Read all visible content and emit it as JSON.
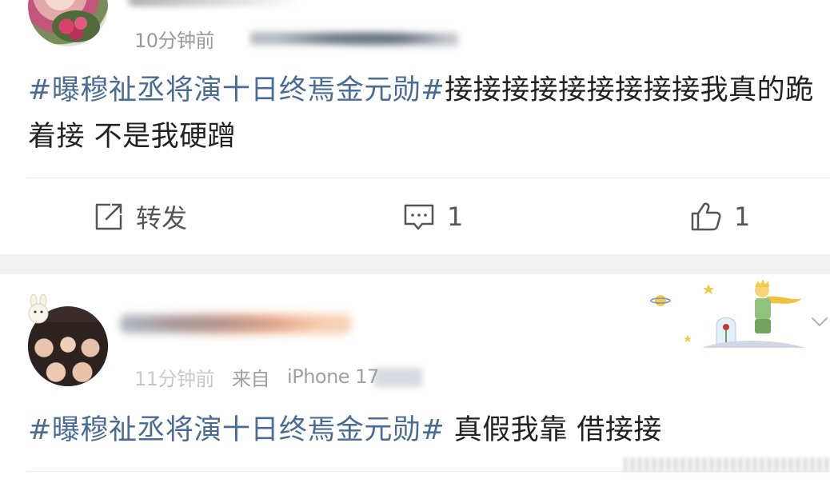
{
  "post1": {
    "time": "10分钟前",
    "hashtag": "#曝穆祉丞将演十日终焉金元勋#",
    "body": "接接接接接接接接接我真的跪着接 不是我硬蹭",
    "actions": {
      "repost_label": "转发",
      "comment_count": "1",
      "like_count": "1"
    }
  },
  "post2": {
    "time": "11分钟前",
    "source_prefix": "来自",
    "source": "iPhone 17",
    "hashtag": "#曝穆祉丞将演十日终焉金元勋#",
    "body": " 真假我靠 借接接"
  },
  "icons": [
    "repost-icon",
    "comment-icon",
    "like-icon",
    "chevron-down-icon"
  ],
  "colors": {
    "hashtag": "#4a6b96",
    "text": "#222222",
    "meta": "#9a9a9a",
    "separator": "#f2f2f2"
  }
}
